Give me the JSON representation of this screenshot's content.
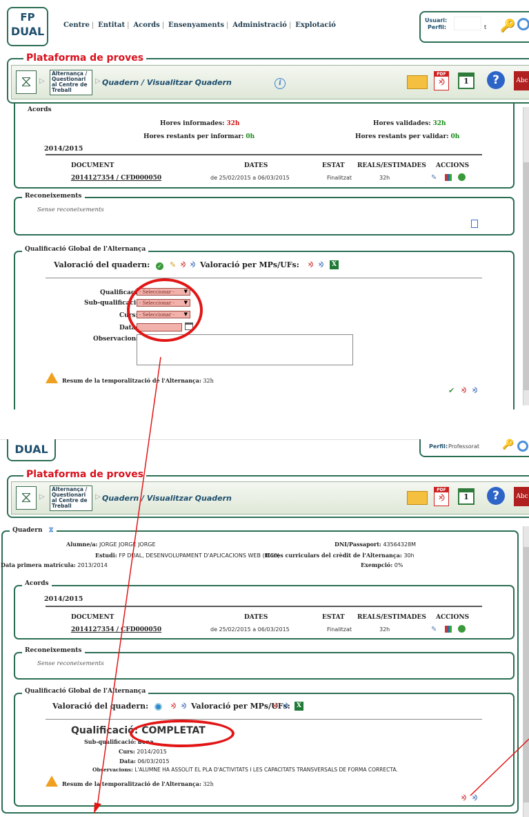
{
  "logo": {
    "line1": "FP",
    "line2": "DUAL"
  },
  "menu": [
    "Centre",
    "Entitat",
    "Acords",
    "Ensenyaments",
    "Administració",
    "Explotació"
  ],
  "user": {
    "usuari_label": "Usuari:",
    "perfil_label": "Perfil:",
    "user_value": "t",
    "perfil_value_bottom": "Professorat"
  },
  "platform_title": "Plataforma de proves",
  "breadcrumb": {
    "box": "Alternança / Questionari al Centre de Treball",
    "page_title": "Quadern / Visualitzar Quadern"
  },
  "top": {
    "acords_legend": "Acords",
    "hores_informades_label": "Hores informades:",
    "hores_informades": "32h",
    "hores_validades_label": "Hores validades:",
    "hores_validades": "32h",
    "restants_informar_label": "Hores restants per informar:",
    "restants_informar": "0h",
    "restants_validar_label": "Hores restants per validar:",
    "restants_validar": "0h",
    "year": "2014/2015",
    "columns": [
      "DOCUMENT",
      "DATES",
      "ESTAT",
      "REALS/ESTIMADES",
      "ACCIONS"
    ],
    "row": {
      "document": "2014127354 / CFD000050",
      "dates": "de 25/02/2015 a 06/03/2015",
      "estat": "Finalitzat",
      "reals": "32h"
    },
    "reconeixements_legend": "Reconeixements",
    "sense": "Sense reconeixements",
    "qualif_legend": "Qualificació Global de l'Alternança",
    "valoracio_quadern": "Valoració del quadern:",
    "valoracio_mps": "Valoració per MPs/UFs:",
    "form_labels": [
      "Qualificació:",
      "Sub-qualificació:",
      "Curs:",
      "Data:",
      "Observacions:"
    ],
    "select_placeholder": "- Seleccionar -",
    "resum_label": "Resum de la temporalització de l'Alternança:",
    "resum_value": "32h"
  },
  "bottom": {
    "quadern_legend": "Quadern",
    "alumne_label": "Alumne/a:",
    "alumne": "JORGE JORGE JORGE",
    "dni_label": "DNI/Passaport:",
    "dni": "43564328M",
    "estudi_label": "Estudi:",
    "estudi": "FP DUAL, DESENVOLUPAMENT D'APLICACIONS WEB (ICC0)",
    "hores_curr_label": "Hores curriculars del crèdit de l'Alternança:",
    "hores_curr": "30h",
    "data_matricula_label": "Data primera matrícula:",
    "data_matricula": "2013/2014",
    "exempcio_label": "Exempció:",
    "exempcio": "0%",
    "acords_legend": "Acords",
    "year": "2014/2015",
    "columns": [
      "DOCUMENT",
      "DATES",
      "ESTAT",
      "REALS/ESTIMADES",
      "ACCIONS"
    ],
    "row": {
      "document": "2014127354 / CFD000050",
      "dates": "de 25/02/2015 a 06/03/2015",
      "estat": "Finalitzat",
      "reals": "32h"
    },
    "reconeixements_legend": "Reconeixements",
    "sense": "Sense reconeixements",
    "qualif_legend": "Qualificació Global de l'Alternança",
    "valoracio_quadern": "Valoració del quadern:",
    "valoracio_mps": "Valoració per MPs/UFs:",
    "qualificacio_label": "Qualificació:",
    "qualificacio": "COMPLETAT",
    "subqual_label": "Sub-qualificació:",
    "subqual": "Bona",
    "curs_label": "Curs:",
    "curs": "2014/2015",
    "data_label": "Data:",
    "data": "06/03/2015",
    "obs_label": "Observacions:",
    "obs": "L'ALUMNE HA ASSOLIT EL PLA D'ACTIVITATS I LES CAPACITATS TRANSVERSALS DE FORMA CORRECTA.",
    "resum_label": "Resum de la temporalització de l'Alternança:",
    "resum_value": "32h"
  },
  "colors": {
    "accent_green": "#2a6e52",
    "platform_red": "#d21010",
    "annotation_red": "#e21515"
  }
}
